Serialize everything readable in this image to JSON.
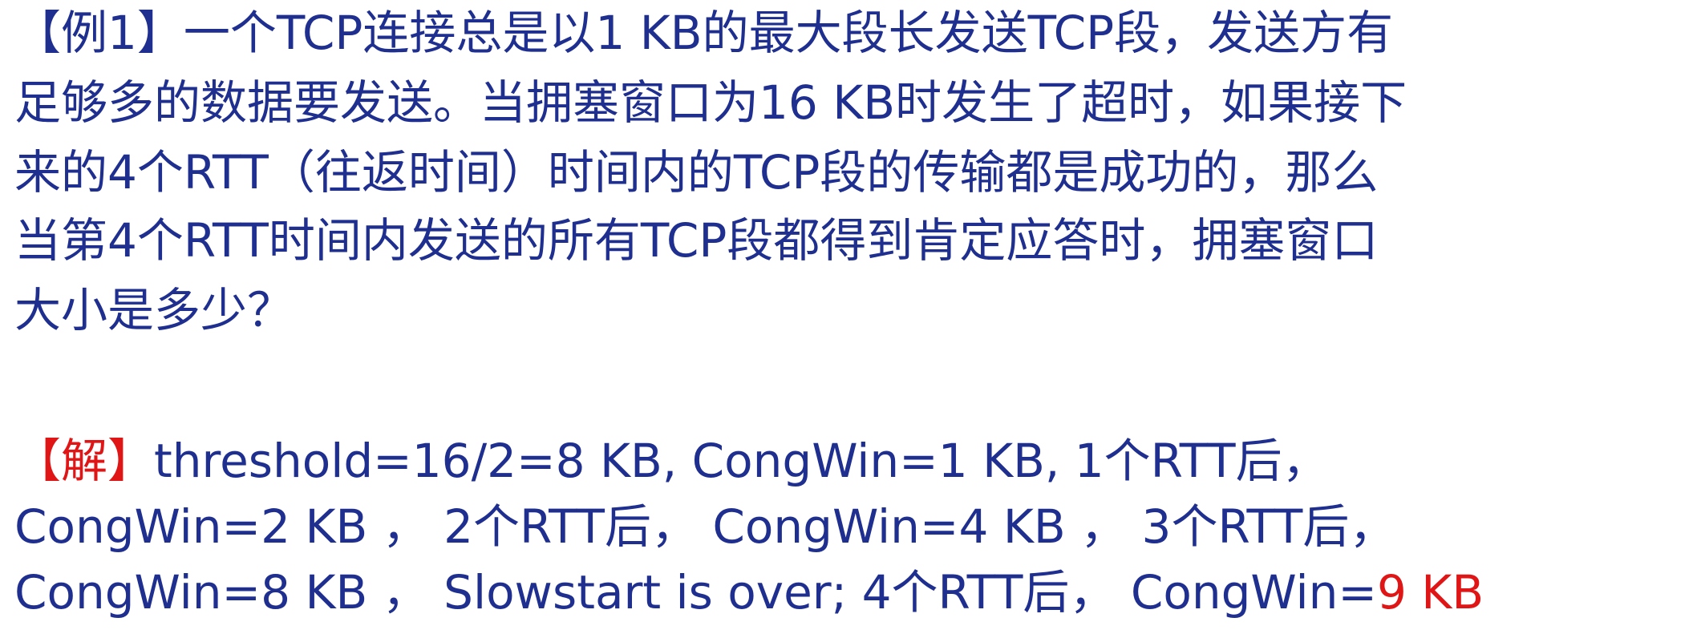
{
  "question": {
    "lines": [
      "【例1】一个TCP连接总是以1 KB的最大段长发送TCP段，发送方有",
      "足够多的数据要发送。当拥塞窗口为16 KB时发生了超时，如果接下",
      "来的4个RTT（往返时间）时间内的TCP段的传输都是成功的，那么",
      "当第4个RTT时间内发送的所有TCP段都得到肯定应答时，拥塞窗口",
      "大小是多少？"
    ]
  },
  "solution": {
    "tag": "【解】",
    "line1_text": "threshold=16/2=8 KB, CongWin=1 KB, 1个RTT后，",
    "line2_text": "CongWin=2 KB ， 2个RTT后， CongWin=4 KB ， 3个RTT后，",
    "line3_text": "CongWin=8 KB ， Slowstart is over; 4个RTT后， CongWin=",
    "answer": "9 KB"
  },
  "colors": {
    "text_blue": "#1f2f8f",
    "highlight_red": "#e01616"
  }
}
